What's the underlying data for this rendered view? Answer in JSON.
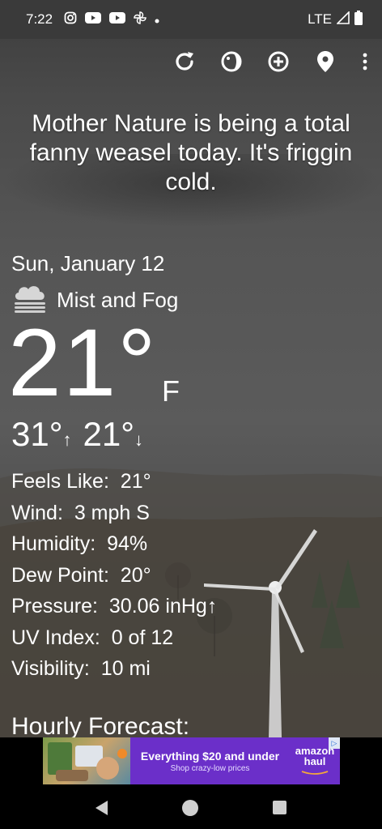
{
  "status_bar": {
    "time": "7:22",
    "network": "LTE",
    "notification_icons": [
      "instagram-icon",
      "youtube-icon",
      "youtube-icon",
      "pinwheel-icon",
      "dot-icon"
    ]
  },
  "toolbar": {
    "icons": [
      "refresh-icon",
      "moon-phase-icon",
      "add-location-icon",
      "location-pin-icon",
      "more-vert-icon"
    ]
  },
  "tagline": "Mother Nature is being a total fanny weasel today. It's friggin cold.",
  "weather": {
    "date": "Sun, January 12",
    "condition": "Mist and Fog",
    "temperature": "21°",
    "unit": "F",
    "high": "31°",
    "low": "21°"
  },
  "details": [
    {
      "label": "Feels Like:",
      "value": "21°"
    },
    {
      "label": "Wind:",
      "value": "3 mph S"
    },
    {
      "label": "Humidity:",
      "value": "94%"
    },
    {
      "label": "Dew Point:",
      "value": "20°"
    },
    {
      "label": "Pressure:",
      "value": "30.06 inHg↑"
    },
    {
      "label": "UV Index:",
      "value": "0 of 12"
    },
    {
      "label": "Visibility:",
      "value": "10 mi"
    }
  ],
  "hourly_heading": "Hourly Forecast:",
  "ad": {
    "title": "Everything $20 and under",
    "subtitle": "Shop crazy-low prices",
    "logo_line1": "amazon",
    "logo_line2": "haul"
  }
}
